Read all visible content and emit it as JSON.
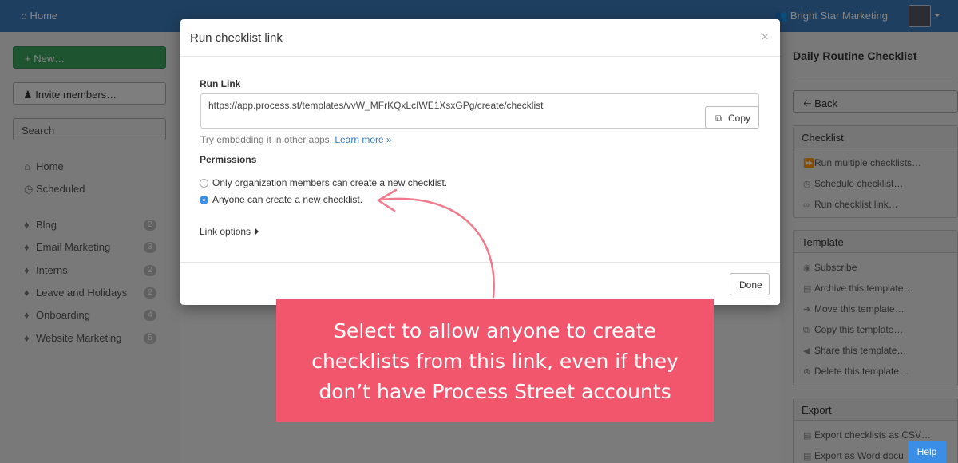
{
  "topbar": {
    "home_label": "Home",
    "org_name": "Bright Star Marketing"
  },
  "left": {
    "new_label": "New…",
    "invite_label": "Invite members…",
    "search_placeholder": "Search",
    "nav": [
      {
        "label": "Home"
      },
      {
        "label": "Scheduled"
      }
    ],
    "folders": [
      {
        "label": "Blog",
        "count": "2"
      },
      {
        "label": "Email Marketing",
        "count": "3"
      },
      {
        "label": "Interns",
        "count": "2"
      },
      {
        "label": "Leave and Holidays",
        "count": "2"
      },
      {
        "label": "Onboarding",
        "count": "4"
      },
      {
        "label": "Website Marketing",
        "count": "5"
      }
    ]
  },
  "right": {
    "title": "Daily Routine Checklist",
    "back_label": "Back",
    "checklist": {
      "heading": "Checklist",
      "items": [
        "Run multiple checklists…",
        "Schedule checklist…",
        "Run checklist link…"
      ]
    },
    "template": {
      "heading": "Template",
      "items": [
        "Subscribe",
        "Archive this template…",
        "Move this template…",
        "Copy this template…",
        "Share this template…",
        "Delete this template…"
      ]
    },
    "export": {
      "heading": "Export",
      "items": [
        "Export checklists as CSV…",
        "Export as Word docu"
      ]
    }
  },
  "modal": {
    "title": "Run checklist link",
    "close": "×",
    "run_link_label": "Run Link",
    "url": "https://app.process.st/templates/vvW_MFrKQxLcIWE1XsxGPg/create/checklist",
    "copy_label": "Copy",
    "hint": "Try embedding it in other apps.",
    "learn_more": "Learn more »",
    "permissions_label": "Permissions",
    "options": [
      {
        "label": "Only organization members can create a new checklist.",
        "selected": false
      },
      {
        "label": "Anyone can create a new checklist.",
        "selected": true
      }
    ],
    "link_options_label": "Link options",
    "done_label": "Done"
  },
  "callout": {
    "lines": [
      "Select to allow anyone to create",
      "checklists from this link, even if they",
      "don’t have Process Street accounts"
    ],
    "color": "#f2566d"
  },
  "help_label": "Help",
  "colors": {
    "brand": "#3c7ab9",
    "success": "#3aa35d",
    "accent": "#3a8ee6"
  }
}
